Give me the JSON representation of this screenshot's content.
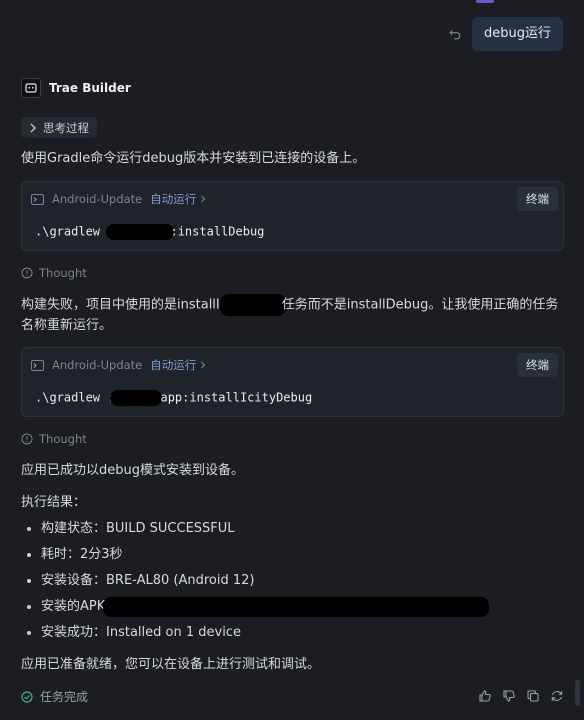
{
  "user_message": "debug运行",
  "assistant": {
    "name": "Trae Builder",
    "think_label": "思考过程"
  },
  "intro_text": "使用Gradle命令运行debug版本并安装到已连接的设备上。",
  "terminals": [
    {
      "name": "Android-Update",
      "auto_run": "自动运行",
      "button": "终端",
      "cmd_prefix": ".\\gradlew :",
      "cmd_suffix": ":installDebug"
    },
    {
      "name": "Android-Update",
      "auto_run": "自动运行",
      "button": "终端",
      "cmd_prefix": ".\\gradlew :",
      "cmd_suffix": "app:installIcityDebug"
    }
  ],
  "thought_label": "Thought",
  "build_fail": {
    "line1_prefix": "构建失败，项目中使用的是installI",
    "line1_suffix": "任务而不是installDebug。让我使用正确的任务",
    "line2": "名称重新运行。"
  },
  "success_text": "应用已成功以debug模式安装到设备。",
  "result_title": "执行结果：",
  "results": [
    "构建状态：BUILD SUCCESSFUL",
    "耗时：2分3秒",
    "安装设备：BRE-AL80 (Android 12)",
    "安装的APK",
    "安装成功：Installed on 1 device"
  ],
  "ready_text": "应用已准备就绪，您可以在设备上进行测试和调试。",
  "status": "任务完成",
  "icons": {
    "undo": "undo-icon",
    "assistant": "robot-icon",
    "chevron": "chevron-right-icon",
    "terminal": "terminal-icon",
    "thought": "lightbulb-icon",
    "done": "check-circle-icon",
    "like": "thumbs-up-icon",
    "dislike": "thumbs-down-icon",
    "copy": "copy-icon",
    "retry": "refresh-icon"
  }
}
